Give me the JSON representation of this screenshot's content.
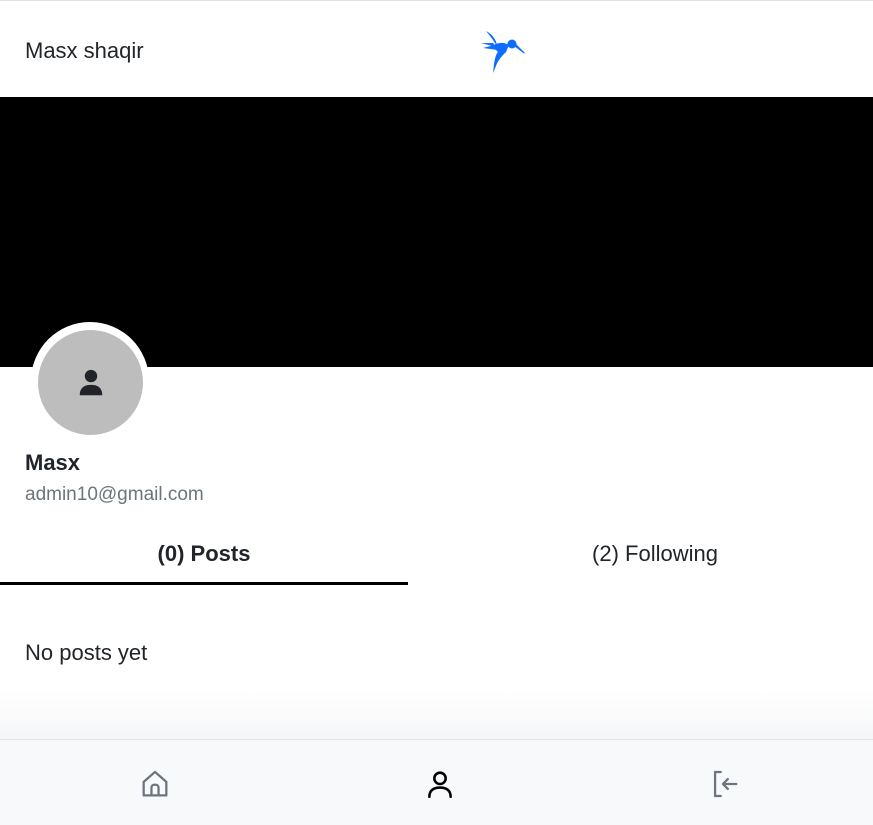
{
  "header": {
    "title": "Masx shaqir",
    "logo_icon": "hummingbird-logo-icon",
    "logo_color": "#0d6efd"
  },
  "cover": {
    "color": "#000000"
  },
  "profile": {
    "avatar_icon": "person-fill-icon",
    "name": "Masx",
    "email": "admin10@gmail.com"
  },
  "tabs": [
    {
      "label": "(0) Posts",
      "active": true
    },
    {
      "label": "(2) Following",
      "active": false
    }
  ],
  "content": {
    "empty_message": "No posts yet"
  },
  "bottom_nav": {
    "items": [
      {
        "icon": "house-icon",
        "active": false
      },
      {
        "icon": "person-icon",
        "active": true
      },
      {
        "icon": "box-arrow-left-icon",
        "active": false
      }
    ]
  }
}
